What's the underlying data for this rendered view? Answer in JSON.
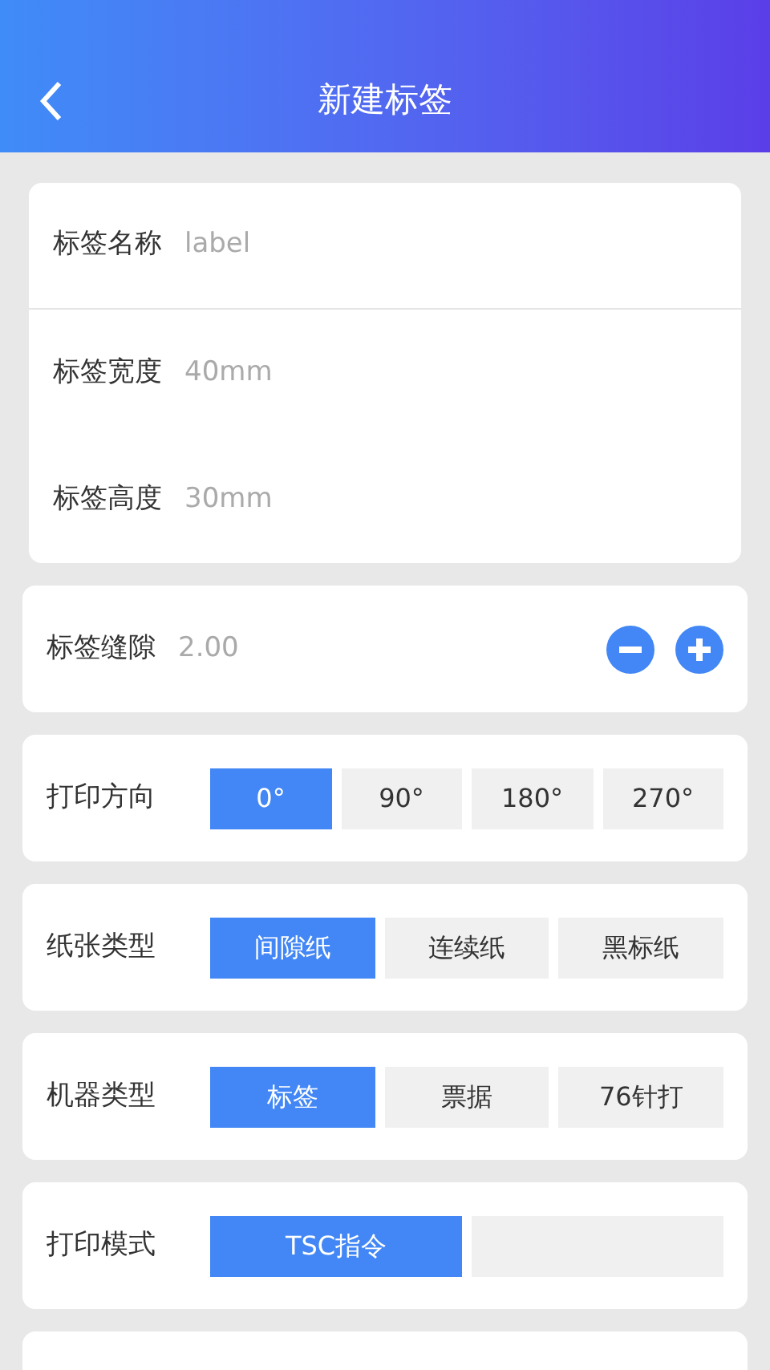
{
  "header": {
    "title": "新建标签"
  },
  "fields": [
    {
      "label": "标签名称",
      "placeholder": "label"
    },
    {
      "label": "标签宽度",
      "placeholder": "40mm"
    },
    {
      "label": "标签高度",
      "placeholder": "30mm"
    }
  ],
  "gap": {
    "label": "标签缝隙",
    "value": "2.00"
  },
  "option_groups": [
    {
      "label": "打印方向",
      "options": [
        {
          "label": "0°",
          "selected": true
        },
        {
          "label": "90°",
          "selected": false
        },
        {
          "label": "180°",
          "selected": false
        },
        {
          "label": "270°",
          "selected": false
        }
      ]
    },
    {
      "label": "纸张类型",
      "options": [
        {
          "label": "间隙纸",
          "selected": true
        },
        {
          "label": "连续纸",
          "selected": false
        },
        {
          "label": "黑标纸",
          "selected": false
        }
      ]
    },
    {
      "label": "机器类型",
      "options": [
        {
          "label": "标签",
          "selected": true
        },
        {
          "label": "票据",
          "selected": false
        },
        {
          "label": "76针打",
          "selected": false
        }
      ]
    },
    {
      "label": "打印模式",
      "options": [
        {
          "label": "TSC指令",
          "selected": true
        },
        {
          "selected": false
        }
      ]
    }
  ]
}
